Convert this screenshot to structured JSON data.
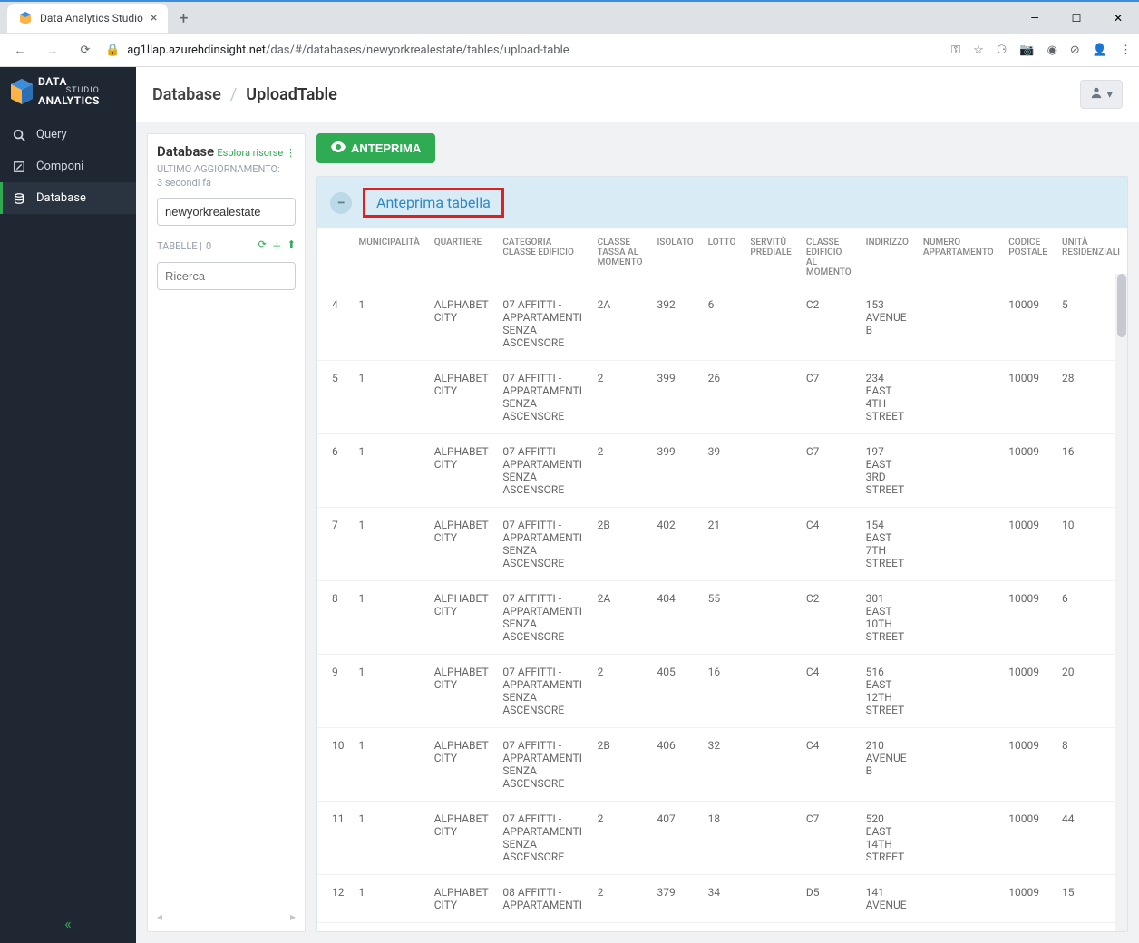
{
  "browser": {
    "tab_title": "Data Analytics Studio",
    "url_host": "ag1llap.azurehdinsight.net",
    "url_path": "/das/#/databases/newyorkrealestate/tables/upload-table"
  },
  "logo": {
    "line1": "DATA",
    "line2": "STUDIO",
    "line3": "ANALYTICS"
  },
  "nav": {
    "query": "Query",
    "compose": "Componi",
    "database": "Database"
  },
  "breadcrumbs": {
    "root": "Database",
    "page": "UploadTable"
  },
  "db_panel": {
    "title": "Database",
    "explore": "Esplora risorse",
    "last_refresh_label": "ULTIMO AGGIORNAMENTO:",
    "last_refresh_value": "3 secondi fa",
    "db_name": "newyorkrealestate",
    "tables_label": "TABELLE |",
    "tables_count": "0",
    "search_placeholder": "Ricerca"
  },
  "preview_button": "ANTEPRIMA",
  "panel_title": "Anteprima tabella",
  "columns": [
    "MUNICIPALITÀ",
    "QUARTIERE",
    "CATEGORIA CLASSE EDIFICIO",
    "CLASSE TASSA AL MOMENTO",
    "ISOLATO",
    "LOTTO",
    "SERVITÙ PREDIALE",
    "CLASSE EDIFICIO AL MOMENTO",
    "INDIRIZZO",
    "NUMERO APPARTAMENTO",
    "CODICE POSTALE",
    "UNITÀ RESIDENZIALI"
  ],
  "rows": [
    {
      "idx": "4",
      "borough": "1",
      "neighborhood": "ALPHABET CITY",
      "category": "07 AFFITTI - APPARTAMENTI SENZA ASCENSORE",
      "taxclass": "2A",
      "block": "392",
      "lot": "6",
      "easement": "",
      "bclass": "C2",
      "address": "153 AVENUE B",
      "apt": "",
      "zip": "10009",
      "units": "5"
    },
    {
      "idx": "5",
      "borough": "1",
      "neighborhood": "ALPHABET CITY",
      "category": "07 AFFITTI - APPARTAMENTI SENZA ASCENSORE",
      "taxclass": "2",
      "block": "399",
      "lot": "26",
      "easement": "",
      "bclass": "C7",
      "address": "234 EAST 4TH STREET",
      "apt": "",
      "zip": "10009",
      "units": "28"
    },
    {
      "idx": "6",
      "borough": "1",
      "neighborhood": "ALPHABET CITY",
      "category": "07 AFFITTI - APPARTAMENTI SENZA ASCENSORE",
      "taxclass": "2",
      "block": "399",
      "lot": "39",
      "easement": "",
      "bclass": "C7",
      "address": "197 EAST 3RD STREET",
      "apt": "",
      "zip": "10009",
      "units": "16"
    },
    {
      "idx": "7",
      "borough": "1",
      "neighborhood": "ALPHABET CITY",
      "category": "07 AFFITTI - APPARTAMENTI SENZA ASCENSORE",
      "taxclass": "2B",
      "block": "402",
      "lot": "21",
      "easement": "",
      "bclass": "C4",
      "address": "154 EAST 7TH STREET",
      "apt": "",
      "zip": "10009",
      "units": "10"
    },
    {
      "idx": "8",
      "borough": "1",
      "neighborhood": "ALPHABET CITY",
      "category": "07 AFFITTI - APPARTAMENTI SENZA ASCENSORE",
      "taxclass": "2A",
      "block": "404",
      "lot": "55",
      "easement": "",
      "bclass": "C2",
      "address": "301 EAST 10TH STREET",
      "apt": "",
      "zip": "10009",
      "units": "6"
    },
    {
      "idx": "9",
      "borough": "1",
      "neighborhood": "ALPHABET CITY",
      "category": "07 AFFITTI - APPARTAMENTI SENZA ASCENSORE",
      "taxclass": "2",
      "block": "405",
      "lot": "16",
      "easement": "",
      "bclass": "C4",
      "address": "516 EAST 12TH STREET",
      "apt": "",
      "zip": "10009",
      "units": "20"
    },
    {
      "idx": "10",
      "borough": "1",
      "neighborhood": "ALPHABET CITY",
      "category": "07 AFFITTI - APPARTAMENTI SENZA ASCENSORE",
      "taxclass": "2B",
      "block": "406",
      "lot": "32",
      "easement": "",
      "bclass": "C4",
      "address": "210 AVENUE B",
      "apt": "",
      "zip": "10009",
      "units": "8"
    },
    {
      "idx": "11",
      "borough": "1",
      "neighborhood": "ALPHABET CITY",
      "category": "07 AFFITTI - APPARTAMENTI SENZA ASCENSORE",
      "taxclass": "2",
      "block": "407",
      "lot": "18",
      "easement": "",
      "bclass": "C7",
      "address": "520 EAST 14TH STREET",
      "apt": "",
      "zip": "10009",
      "units": "44"
    },
    {
      "idx": "12",
      "borough": "1",
      "neighborhood": "ALPHABET CITY",
      "category": "08 AFFITTI - APPARTAMENTI",
      "taxclass": "2",
      "block": "379",
      "lot": "34",
      "easement": "",
      "bclass": "D5",
      "address": "141 AVENUE",
      "apt": "",
      "zip": "10009",
      "units": "15"
    }
  ]
}
